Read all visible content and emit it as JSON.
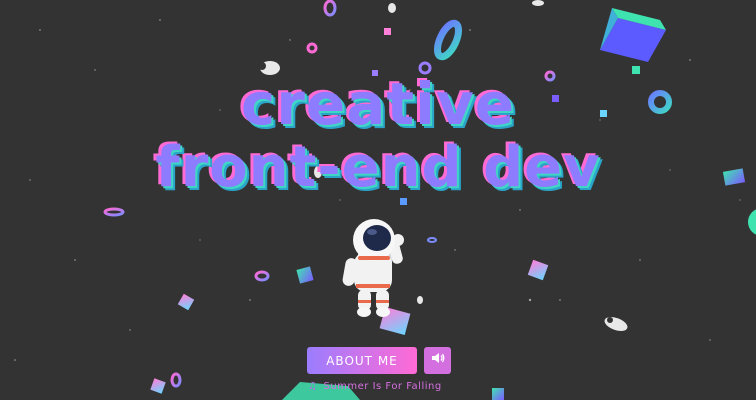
{
  "hero": {
    "title_line1": "creative",
    "title_line2": "front-end dev"
  },
  "actions": {
    "about_label": "ABOUT ME",
    "sound_icon": "speaker-icon"
  },
  "music": {
    "note_icon": "music-note-icon",
    "now_playing": "Summer Is For Falling"
  },
  "colors": {
    "background": "#333333",
    "title_primary": "#8d7cff",
    "accent_pink": "#ff6ad5",
    "accent_teal": "#3fd6c6"
  }
}
